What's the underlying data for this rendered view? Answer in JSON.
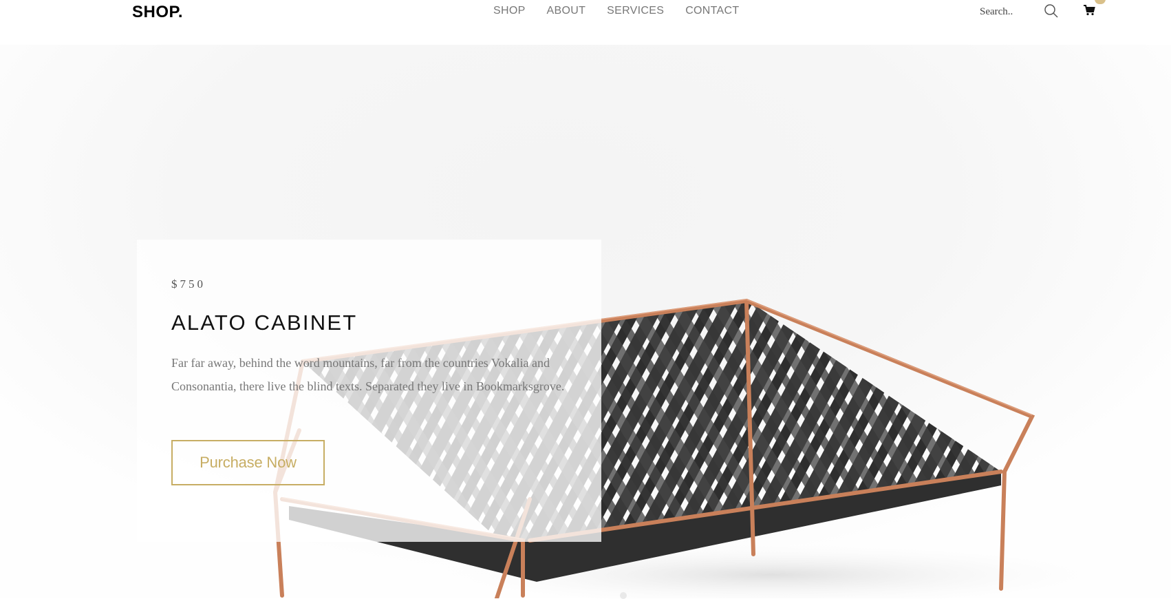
{
  "header": {
    "logo": "SHOP.",
    "nav": [
      "SHOP",
      "ABOUT",
      "SERVICES",
      "CONTACT"
    ],
    "search_placeholder": "Search..",
    "icons": {
      "search": "search-icon",
      "cart": "cart-icon"
    },
    "accent_color": "#d9c08a"
  },
  "hero": {
    "price": "$750",
    "title": "ALATO CABINET",
    "description": "Far far away, behind the word mountains, far from the countries Vokalia and Consonantia, there live the blind texts. Separated they live in Bookmarksgrove.",
    "button_label": "Purchase Now",
    "button_color": "#c7ad63",
    "image": "copper-frame-lounge-chair-with-black-woven-straps"
  }
}
